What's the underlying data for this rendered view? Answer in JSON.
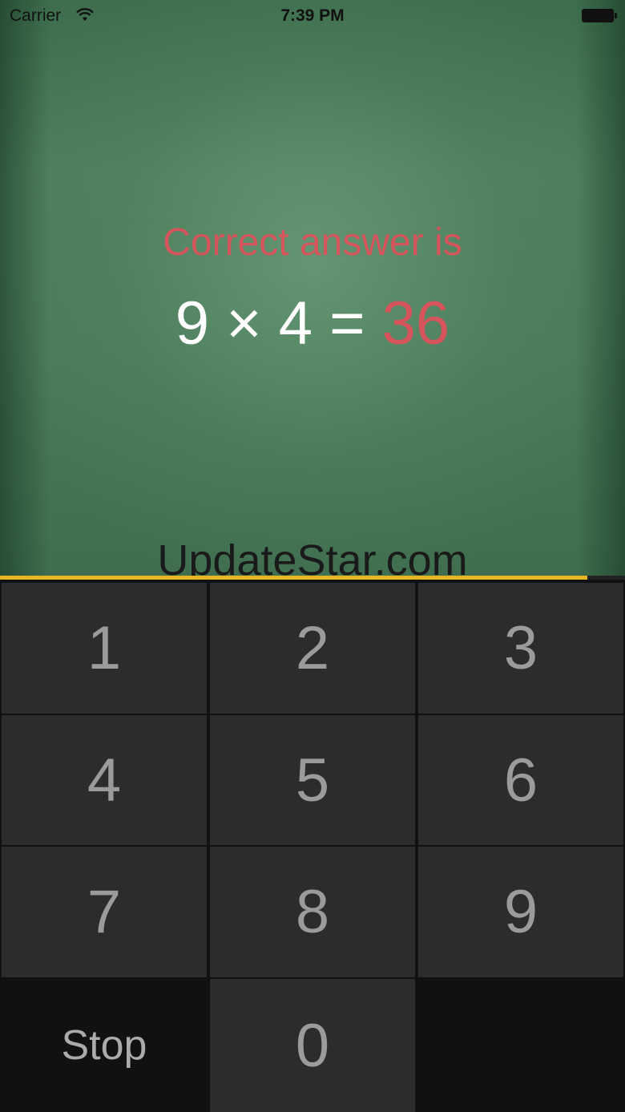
{
  "status_bar": {
    "carrier": "Carrier",
    "time": "7:39 PM"
  },
  "feedback": {
    "message": "Correct answer is",
    "operand_a": "9",
    "operator": "×",
    "operand_b": "4",
    "equals": "=",
    "answer": "36"
  },
  "watermark": "UpdateStar.com",
  "timer": {
    "progress": 0.94,
    "color": "#e6b722"
  },
  "keypad": {
    "keys": [
      "1",
      "2",
      "3",
      "4",
      "5",
      "6",
      "7",
      "8",
      "9"
    ],
    "stop_label": "Stop",
    "zero_label": "0"
  },
  "colors": {
    "accent_red": "#d6545c",
    "key_bg": "#2c2c2e",
    "keypad_bg": "#111111"
  }
}
